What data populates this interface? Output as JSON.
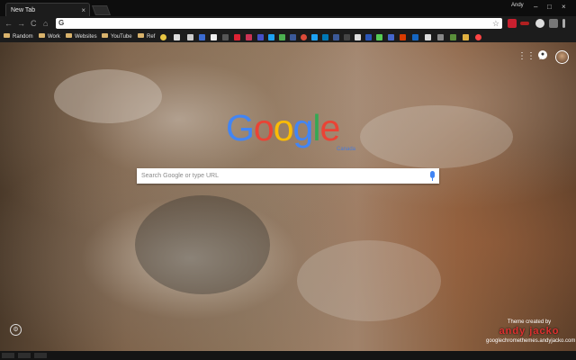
{
  "tab": {
    "title": "New Tab",
    "close": "×"
  },
  "window": {
    "user": "Andy",
    "minimize": "–",
    "maximize": "□",
    "close": "×"
  },
  "nav": {
    "back": "←",
    "forward": "→",
    "reload": "C",
    "home": "⌂"
  },
  "omnibox": {
    "value": "",
    "star": "☆",
    "g": "G"
  },
  "bookmarks": [
    {
      "label": "Random"
    },
    {
      "label": "Work"
    },
    {
      "label": "Websites"
    },
    {
      "label": "YouTube"
    },
    {
      "label": "Ref"
    }
  ],
  "ntp": {
    "logo": [
      "G",
      "o",
      "o",
      "g",
      "l",
      "e"
    ],
    "logo_colors": [
      "#4285f4",
      "#ea4335",
      "#fbbc05",
      "#4285f4",
      "#34a853",
      "#ea4335"
    ],
    "logo_sub": "Canada",
    "search_placeholder": "Search Google or type URL",
    "apps": "⋮⋮⋮",
    "bell": "●"
  },
  "credit": {
    "line1": "Theme created by",
    "line2": "andy jacko",
    "line3": "googlechromethemes.andyjacko.com"
  },
  "settings": "⚙"
}
